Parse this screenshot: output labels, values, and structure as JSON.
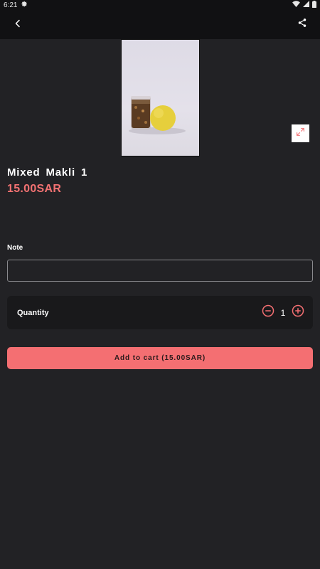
{
  "status_bar": {
    "time": "6:21",
    "icons": [
      "settings-icon",
      "wifi-icon",
      "signal-icon",
      "battery-icon"
    ]
  },
  "app_bar": {
    "back_icon": "back-arrow-icon",
    "share_icon": "share-icon"
  },
  "product": {
    "name": "Mixed  Makli  1",
    "price": "15.00SAR",
    "expand_icon": "expand-icon"
  },
  "note": {
    "label": "Note",
    "value": "",
    "placeholder": ""
  },
  "quantity": {
    "label": "Quantity",
    "value": "1",
    "minus_icon": "minus-circle-icon",
    "plus_icon": "plus-circle-icon"
  },
  "cart": {
    "add_label": "Add to cart (15.00SAR)"
  },
  "colors": {
    "background": "#222225",
    "app_bar": "#111113",
    "accent": "#f46f72",
    "card": "#19191b"
  }
}
